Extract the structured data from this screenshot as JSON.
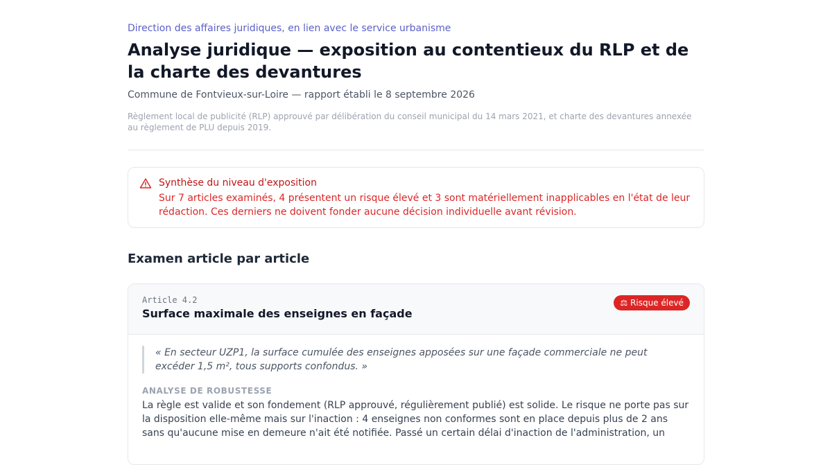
{
  "header": {
    "department": "Direction des affaires juridiques, en lien avec le service urbanisme",
    "title": "Analyse juridique — exposition au contentieux du RLP et de la charte des devantures",
    "subtitle": "Commune de Fontvieux-sur-Loire — rapport établi le 8 septembre 2026",
    "note": "Règlement local de publicité (RLP) approuvé par délibération du conseil municipal du 14 mars 2021, et charte des devantures annexée au règlement de PLU depuis 2019."
  },
  "alert": {
    "icon": "warning-triangle-icon",
    "title": "Synthèse du niveau d'exposition",
    "text": "Sur 7 articles examinés, 4 présentent un risque élevé et 3 sont matériellement inapplicables en l'état de leur rédaction. Ces derniers ne doivent fonder aucune décision individuelle avant révision.",
    "color": "#dc2626"
  },
  "section": {
    "title": "Examen article par article"
  },
  "article": {
    "number": "Article 4.2",
    "title": "Surface maximale des enseignes en façade",
    "badge": "Risque élevé",
    "badge_icon": "scales-icon",
    "badge_color": "#dc2626",
    "quote": "« En secteur UZP1, la surface cumulée des enseignes apposées sur une façade commerciale ne peut excéder 1,5 m², tous supports confondus. »",
    "analysis_label": "ANALYSE DE ROBUSTESSE",
    "analysis": "La règle est valide et son fondement (RLP approuvé, régulièrement publié) est solide. Le risque ne porte pas sur la disposition elle-même mais sur l'inaction : 4 enseignes non conformes sont en place depuis plus de 2 ans sans qu'aucune mise en demeure n'ait été notifiée. Passé un certain délai d'inaction de l'administration, un"
  }
}
